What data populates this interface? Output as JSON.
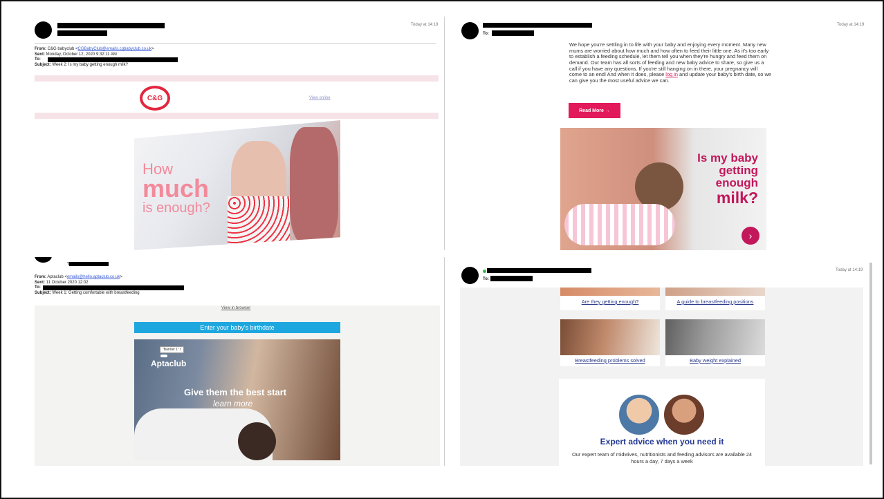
{
  "panel1": {
    "timestamp": "Today at 14:19",
    "from_label": "From:",
    "from_name": "C&G babyclub <",
    "from_email": "CGBabyClub@emails.cgbabyclub.co.uk",
    "from_close": ">",
    "sent_label": "Sent:",
    "sent_value": "Monday, October 12, 2020 9:32:11 AM",
    "to_label": "To:",
    "subject_label": "Subject:",
    "subject_value": "Week 2: Is my baby getting enough milk?",
    "logo_text": "C&G",
    "view_online": "View online",
    "hero_how": "How",
    "hero_much": "much",
    "hero_enough": "is enough?"
  },
  "panel2": {
    "timestamp": "Today at 14:19",
    "to_label": "To:",
    "body_before_link": "We hope you're settling in to life with your baby and enjoying every moment. Many new mums are worried about how much and how often to feed their little one. As it's too early to establish a feeding schedule, let them tell you when they're hungry and feed them on demand. Our team has all sorts of feeding and new baby advice to share, so give us a call if you have any questions. If you're still hanging on in there, your pregnancy will come to an end! And when it does, please ",
    "link_text": "log in",
    "body_after_link": " and update your baby's birth date, so we can give you the most useful advice we can.",
    "read_more": "Read More →",
    "hero_line1": "Is my baby",
    "hero_line2": "getting",
    "hero_line3": "enough",
    "hero_line4": "milk?",
    "hero_arrow": "›"
  },
  "panel3": {
    "to_label": "To:",
    "from_label": "From:",
    "from_name": "Aptaclub <",
    "from_email": "emails@hello.aptaclub.co.uk",
    "from_close": ">",
    "sent_label": "Sent:",
    "sent_value": "11 October 2020 12:02",
    "to_label2": "To:",
    "subject_label": "Subject:",
    "subject_value": "Week 1: Getting comfortable with breastfeeding",
    "view_in_browser": "View in browser",
    "birthdate_bar": "Enter your baby's birthdate",
    "banner_tag": "\"Banner 1\" t",
    "brand": "Aptaclub",
    "give": "Give them the best start",
    "learn_more": "learn more"
  },
  "panel4": {
    "timestamp": "Today at 14:19",
    "to_label": "To:",
    "cards": [
      {
        "caption": "Are they getting enough?"
      },
      {
        "caption": "A guide to breastfeeding positions"
      },
      {
        "caption": "Breastfeeding problems solved"
      },
      {
        "caption": "Baby weight explained"
      }
    ],
    "expert_title": "Expert advice when you need it",
    "expert_body": "Our expert team of midwives, nutritionists and feeding advisors are available 24 hours a day, 7 days a week"
  },
  "colors": {
    "cg_red": "#e3263f",
    "pink_cta": "#e2195a",
    "apta_blue": "#1ea7df",
    "expert_navy": "#253a94"
  }
}
